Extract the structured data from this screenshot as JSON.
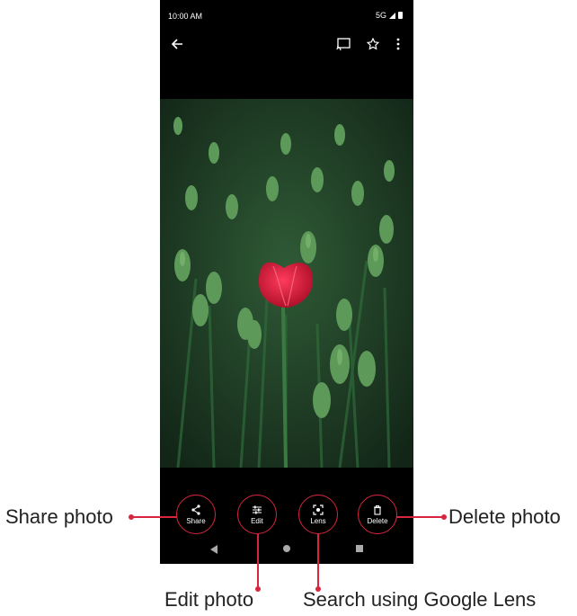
{
  "status_bar": {
    "time": "10:00 AM",
    "network": "5G"
  },
  "top_bar": {
    "back_icon": "arrow-left-icon",
    "cast_icon": "cast-icon",
    "favorite_icon": "star-icon",
    "more_icon": "more-vert-icon"
  },
  "photo": {
    "description_icon": "tulip-photo"
  },
  "actions": [
    {
      "label": "Share",
      "icon": "share-icon"
    },
    {
      "label": "Edit",
      "icon": "tune-icon"
    },
    {
      "label": "Lens",
      "icon": "lens-icon"
    },
    {
      "label": "Delete",
      "icon": "trash-icon"
    }
  ],
  "callouts": {
    "share": "Share photo",
    "edit": "Edit photo",
    "lens": "Search using Google Lens",
    "delete": "Delete photo"
  },
  "colors": {
    "accent": "#d7263d"
  }
}
